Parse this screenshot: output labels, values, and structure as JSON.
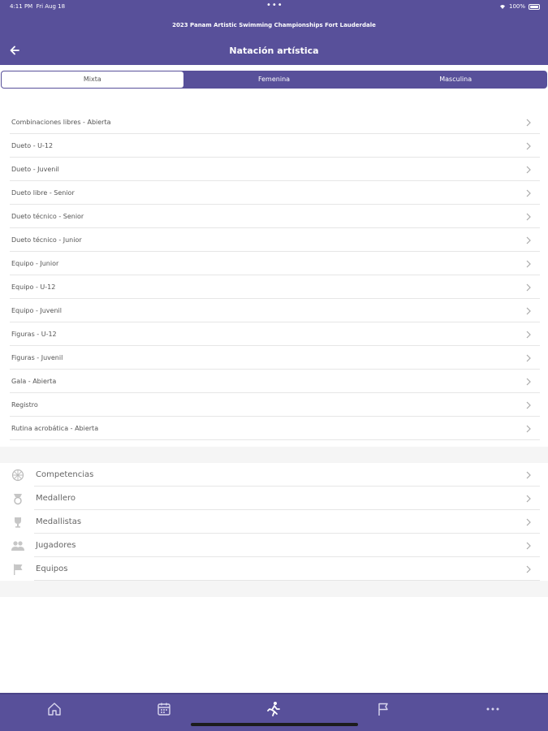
{
  "status_bar": {
    "time": "4:11 PM",
    "date": "Fri Aug 18",
    "battery": "100%"
  },
  "app_title": "2023 Panam Artistic Swimming Championships Fort Lauderdale",
  "header": {
    "title": "Natación artística"
  },
  "segments": [
    {
      "label": "Mixta",
      "active": true
    },
    {
      "label": "Femenina",
      "active": false
    },
    {
      "label": "Masculina",
      "active": false
    }
  ],
  "events": [
    "Combinaciones libres - Abierta",
    "Dueto - U-12",
    "Dueto - Juvenil",
    "Dueto libre - Senior",
    "Dueto técnico - Senior",
    "Dueto técnico - Junior",
    "Equipo - Junior",
    "Equipo - U-12",
    "Equipo - Juvenil",
    "Figuras - U-12",
    "Figuras - Juvenil",
    "Gala - Abierta",
    "Registro",
    "Rutina acrobática - Abierta"
  ],
  "menu": [
    {
      "label": "Competencias",
      "icon": "competitions-icon"
    },
    {
      "label": "Medallero",
      "icon": "medal-table-icon"
    },
    {
      "label": "Medallistas",
      "icon": "trophy-icon"
    },
    {
      "label": "Jugadores",
      "icon": "players-icon"
    },
    {
      "label": "Equipos",
      "icon": "flag-icon"
    }
  ],
  "tabs": [
    {
      "name": "tab-home",
      "icon": "home-icon"
    },
    {
      "name": "tab-schedule",
      "icon": "calendar-icon"
    },
    {
      "name": "tab-sports",
      "icon": "runner-icon"
    },
    {
      "name": "tab-teams",
      "icon": "flag-icon"
    },
    {
      "name": "tab-more",
      "icon": "more-icon"
    }
  ],
  "colors": {
    "primary": "#58509a",
    "row_text": "#555555",
    "separator": "#e6e6e6",
    "band": "#f5f5f5"
  }
}
